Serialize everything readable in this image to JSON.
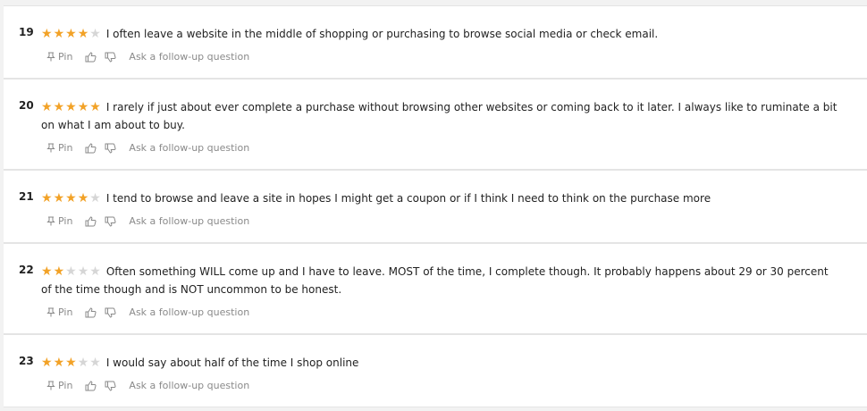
{
  "actions": {
    "pin_label": "Pin",
    "follow_up_label": "Ask a follow-up question"
  },
  "colors": {
    "star_filled": "#f2a227",
    "star_empty": "#d6d6d6"
  },
  "responses": [
    {
      "number": "19",
      "rating": 4,
      "text": "I often leave a website in the middle of shopping or purchasing to browse social media or check email."
    },
    {
      "number": "20",
      "rating": 5,
      "text": "I rarely if just about ever complete a purchase without browsing other websites or coming back to it later. I always like to ruminate a bit on what I am about to buy."
    },
    {
      "number": "21",
      "rating": 4,
      "text": "I tend to browse and leave a site in hopes I might get a coupon or if I think I need to think on the purchase more"
    },
    {
      "number": "22",
      "rating": 2,
      "text": "Often something WILL come up and I have to leave. MOST of the time, I complete though. It probably happens about 29 or 30 percent of the time though and is NOT uncommon to be honest."
    },
    {
      "number": "23",
      "rating": 3,
      "text": "I would say about half of the time I shop online"
    }
  ]
}
